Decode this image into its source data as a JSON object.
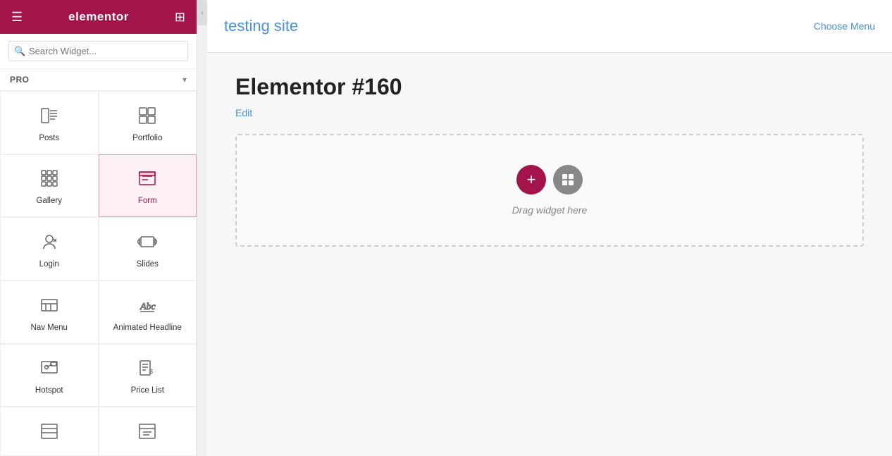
{
  "header": {
    "title": "elementor",
    "hamburger_icon": "☰",
    "grid_icon": "⊞"
  },
  "search": {
    "placeholder": "Search Widget...",
    "icon": "🔍"
  },
  "filter": {
    "label": "PRO",
    "chevron": "▾"
  },
  "widgets": [
    {
      "id": "posts",
      "label": "Posts",
      "icon_type": "posts"
    },
    {
      "id": "portfolio",
      "label": "Portfolio",
      "icon_type": "portfolio"
    },
    {
      "id": "gallery",
      "label": "Gallery",
      "icon_type": "gallery"
    },
    {
      "id": "form",
      "label": "Form",
      "icon_type": "form",
      "active": true
    },
    {
      "id": "login",
      "label": "Login",
      "icon_type": "login"
    },
    {
      "id": "slides",
      "label": "Slides",
      "icon_type": "slides"
    },
    {
      "id": "nav-menu",
      "label": "Nav Menu",
      "icon_type": "navmenu"
    },
    {
      "id": "animated-headline",
      "label": "Animated Headline",
      "icon_type": "animated"
    },
    {
      "id": "hotspot",
      "label": "Hotspot",
      "icon_type": "hotspot"
    },
    {
      "id": "price-list",
      "label": "Price List",
      "icon_type": "pricelist"
    },
    {
      "id": "widget-11",
      "label": "",
      "icon_type": "generic1"
    },
    {
      "id": "widget-12",
      "label": "",
      "icon_type": "generic2"
    }
  ],
  "topbar": {
    "site_title": "testing site",
    "choose_menu": "Choose Menu"
  },
  "canvas": {
    "page_title": "Elementor #160",
    "edit_label": "Edit",
    "drop_text": "Drag widget here",
    "add_btn": "+",
    "template_btn": "▣"
  }
}
